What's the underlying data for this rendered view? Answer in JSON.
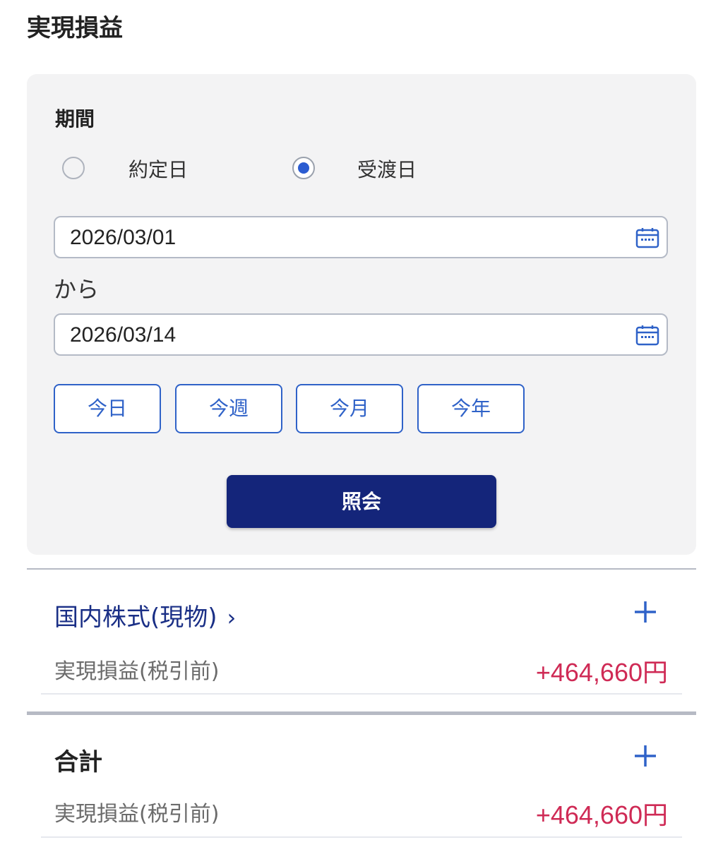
{
  "page": {
    "title": "実現損益"
  },
  "filter": {
    "period_label": "期間",
    "radios": [
      {
        "label": "約定日",
        "checked": false
      },
      {
        "label": "受渡日",
        "checked": true
      }
    ],
    "from_date": "2026/03/01",
    "from_suffix": "から",
    "to_date": "2026/03/14",
    "quick_buttons": [
      "今日",
      "今週",
      "今月",
      "今年"
    ],
    "submit_label": "照会"
  },
  "sections": [
    {
      "title": "国内株式(現物)",
      "has_chevron": true,
      "pl_label": "実現損益(税引前)",
      "pl_value": "+464,660円"
    },
    {
      "title": "合計",
      "has_chevron": false,
      "pl_label": "実現損益(税引前)",
      "pl_value": "+464,660円"
    }
  ],
  "colors": {
    "accent": "#2f62c8",
    "primary_button": "#14257a",
    "profit": "#cf2a55",
    "radio_checked": "#2b5cd1"
  },
  "icons": {
    "date_picker": "calendar-icon",
    "expand": "plus-icon",
    "navigate": "chevron-right-icon"
  }
}
